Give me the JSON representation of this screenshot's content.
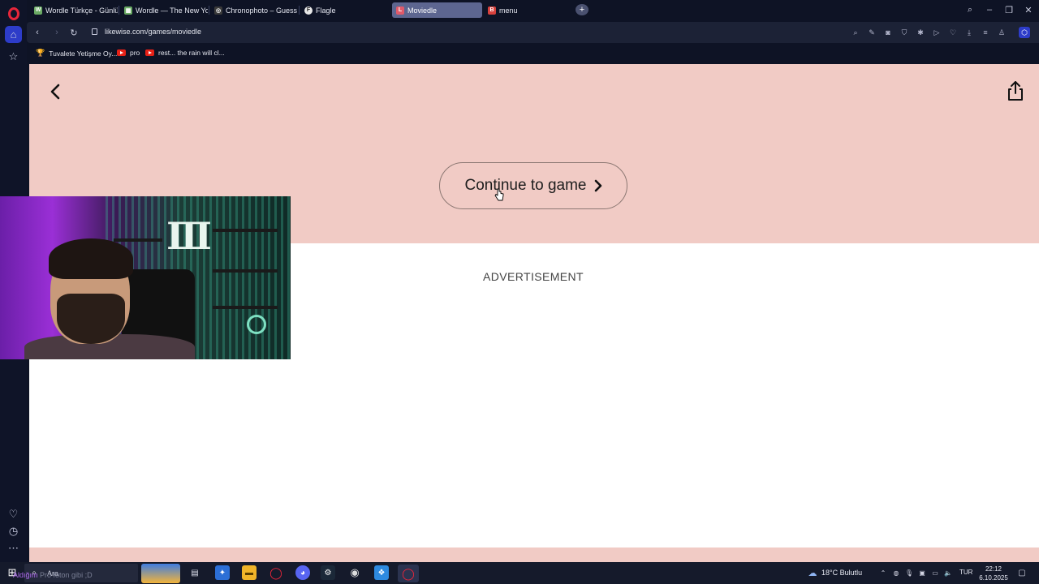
{
  "browser": {
    "tabs": [
      {
        "label": "Wordle Türkçe - Günlük K",
        "favicon": "W",
        "favicon_color": "#6aaa64",
        "active": false
      },
      {
        "label": "Wordle — The New York",
        "favicon": "▦",
        "favicon_color": "#6aaa64",
        "active": false
      },
      {
        "label": "Chronophoto – Guess the",
        "favicon": "◎",
        "favicon_color": "#3a3a3a",
        "active": false
      },
      {
        "label": "Flagle",
        "favicon": "F",
        "favicon_color": "#f2f2f2",
        "active": false
      },
      {
        "label": "Moviedle",
        "favicon": "L",
        "favicon_color": "#e05a6a",
        "active": true
      },
      {
        "label": "menu",
        "favicon": "B",
        "favicon_color": "#d8413d",
        "active": false
      }
    ],
    "url": "likewise.com/games/moviedle",
    "bookmarks": [
      {
        "label": "Tuvalete Yetişme Oy...",
        "icon": "trophy-icon"
      },
      {
        "label": "pro",
        "icon": "youtube-icon"
      },
      {
        "label": "rest... the rain will cl...",
        "icon": "youtube-icon"
      }
    ]
  },
  "page": {
    "continue_label": "Continue to game",
    "ad_label": "ADVERTISEMENT",
    "hero_color": "#f1cbc5"
  },
  "taskbar": {
    "search_placeholder": "Ara",
    "search_overlay_prefix": "Aldığım",
    "search_overlay_rest": "Pro foton gibi ;D",
    "weather": "18°C  Bulutlu",
    "language": "TUR",
    "time": "22:12",
    "date": "6.10.2025"
  }
}
